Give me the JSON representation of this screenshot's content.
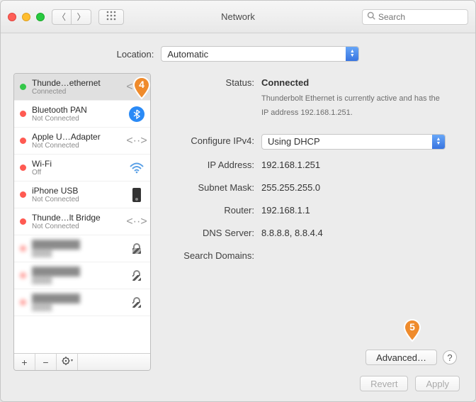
{
  "window": {
    "title": "Network"
  },
  "toolbar": {
    "search_placeholder": "Search"
  },
  "location": {
    "label": "Location:",
    "value": "Automatic"
  },
  "sidebar": {
    "items": [
      {
        "name": "Thunde…ethernet",
        "status": "Connected",
        "dot": "green",
        "icon": "ethernet"
      },
      {
        "name": "Bluetooth PAN",
        "status": "Not Connected",
        "dot": "red",
        "icon": "bluetooth"
      },
      {
        "name": "Apple U…Adapter",
        "status": "Not Connected",
        "dot": "red",
        "icon": "ethernet"
      },
      {
        "name": "Wi-Fi",
        "status": "Off",
        "dot": "red",
        "icon": "wifi"
      },
      {
        "name": "iPhone USB",
        "status": "Not Connected",
        "dot": "red",
        "icon": "phone"
      },
      {
        "name": "Thunde…lt Bridge",
        "status": "Not Connected",
        "dot": "red",
        "icon": "ethernet"
      }
    ],
    "add": "+",
    "remove": "−",
    "action": "✻▾"
  },
  "detail": {
    "status_label": "Status:",
    "status_value": "Connected",
    "status_sub": "Thunderbolt Ethernet is currently active and has the IP address 192.168.1.251.",
    "configure_label": "Configure IPv4:",
    "configure_value": "Using DHCP",
    "ip_label": "IP Address:",
    "ip_value": "192.168.1.251",
    "mask_label": "Subnet Mask:",
    "mask_value": "255.255.255.0",
    "router_label": "Router:",
    "router_value": "192.168.1.1",
    "dns_label": "DNS Server:",
    "dns_value": "8.8.8.8, 8.8.4.4",
    "search_label": "Search Domains:",
    "search_value": "",
    "advanced": "Advanced…",
    "help": "?"
  },
  "footer": {
    "revert": "Revert",
    "apply": "Apply"
  },
  "callouts": {
    "c4": "4",
    "c5": "5"
  }
}
